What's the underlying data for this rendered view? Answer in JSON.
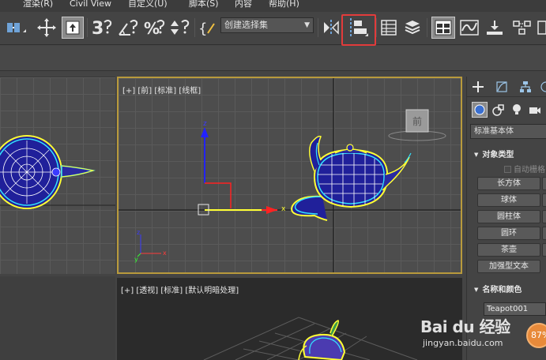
{
  "menubar": {
    "items": [
      "渲染(R)",
      "Civil View",
      "自定义(U)",
      "脚本(S)",
      "内容",
      "帮助(H)"
    ]
  },
  "toolbar": {
    "selection_set_placeholder": "创建选择集",
    "highlight_color": "#e23b3b",
    "icons": [
      "snap-toggle-icon",
      "move-icon",
      "select-object-icon",
      "snap-3d-icon",
      "angle-snap-icon",
      "percent-snap-icon",
      "spinner-snap-icon",
      "edit-named-selection-icon",
      "mirror-icon",
      "align-icon",
      "scene-explorer-icon",
      "layer-explorer-icon",
      "ribbon-toggle-icon",
      "curve-editor-icon",
      "schematic-view-icon",
      "material-editor-icon"
    ]
  },
  "viewports": {
    "front_label": "[+] [前] [标准] [线框]",
    "persp_label": "[+] [透视] [标准] [默认明暗处理]",
    "active_border_color": "#b89a3c",
    "viewcube_label": "前",
    "axis_x": "x",
    "axis_z": "z",
    "axis_y": "y"
  },
  "command_panel": {
    "category_dropdown": "标准基本体",
    "object_type_header": "对象类型",
    "auto_grid_label": "自动栅格",
    "object_buttons": [
      "长方体",
      "球体",
      "圆柱体",
      "圆环",
      "茶壶",
      "加强型文本"
    ],
    "name_color_header": "名称和颜色",
    "object_name": "Teapot001"
  },
  "watermark": {
    "logo": "Bai du 经验",
    "url": "jingyan.baidu.com"
  },
  "badge": {
    "value": "87%"
  }
}
